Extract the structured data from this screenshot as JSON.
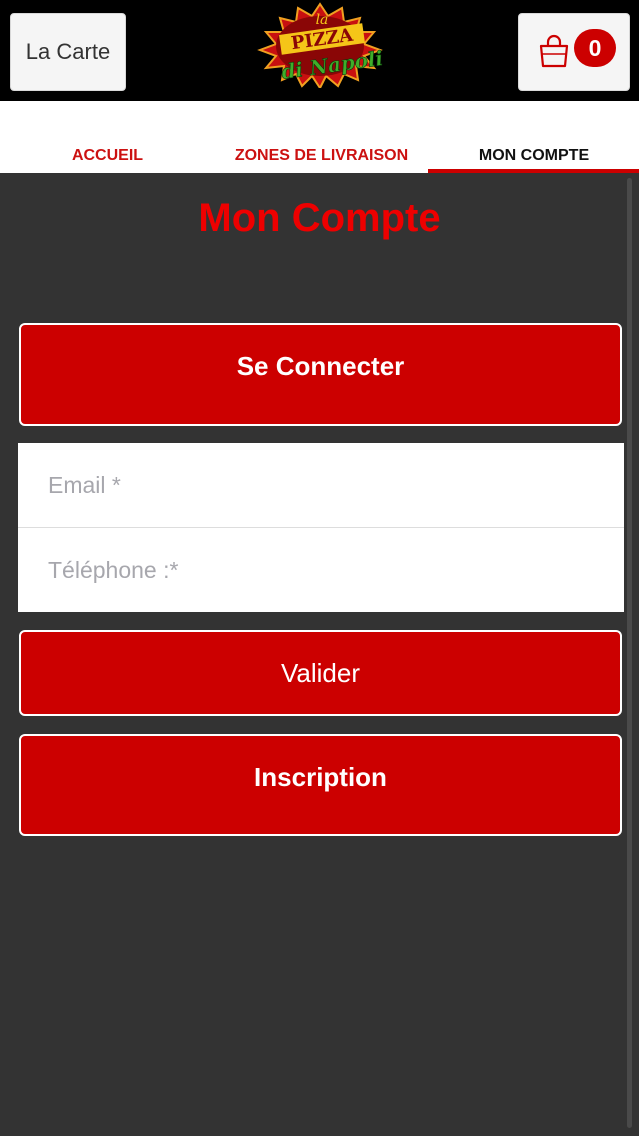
{
  "header": {
    "menu_label": "La Carte",
    "logo_text": "La Pizza di Napoli",
    "cart_count": "0"
  },
  "nav": {
    "tabs": [
      {
        "label": "ACCUEIL"
      },
      {
        "label": "ZONES DE LIVRAISON"
      },
      {
        "label": "MON COMPTE"
      }
    ],
    "active_tab": "MON COMPTE"
  },
  "page": {
    "title": "Mon Compte",
    "connect_label": "Se Connecter",
    "email_placeholder": "Email *",
    "phone_placeholder": "Téléphone :*",
    "submit_label": "Valider",
    "register_label": "Inscription"
  },
  "colors": {
    "brand_red": "#cc0000",
    "header_bg": "#000000",
    "body_bg": "#333333"
  },
  "icons": [
    "shopping-bag-icon"
  ]
}
